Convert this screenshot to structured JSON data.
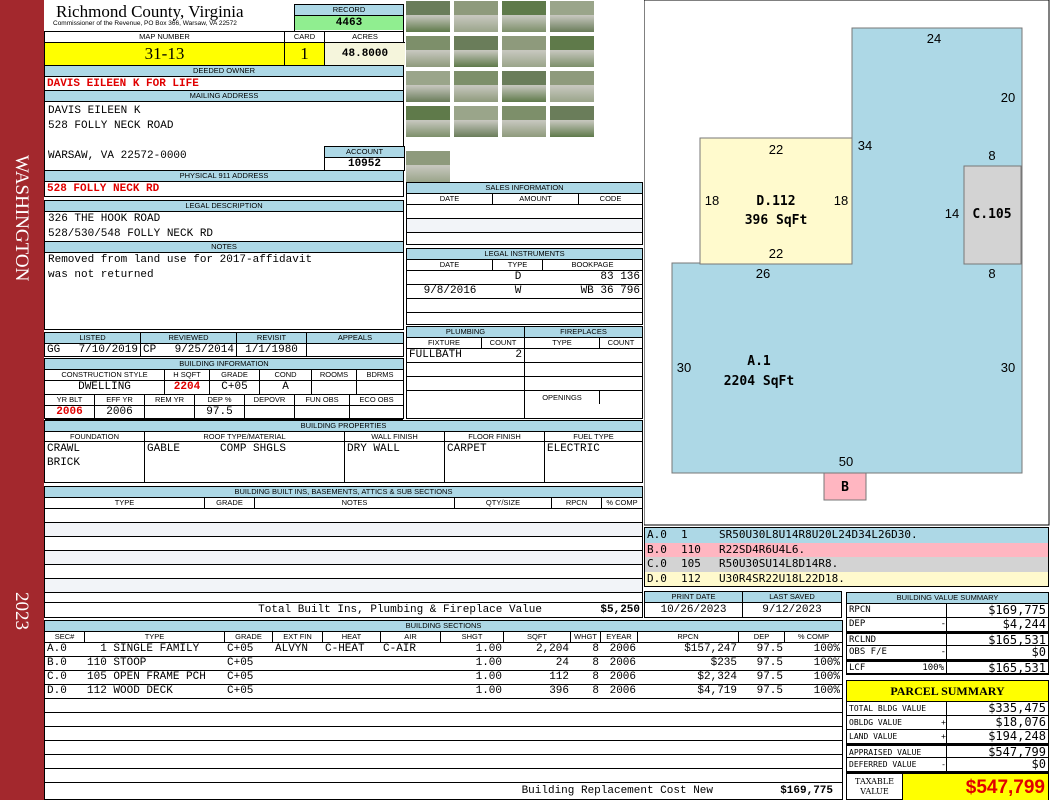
{
  "side": {
    "district": "WASHINGTON",
    "year": "2023"
  },
  "header": {
    "county": "Richmond County, Virginia",
    "subtitle": "Commissioner of the Revenue, PO Box 366, Warsaw, VA 22572",
    "record_label": "RECORD",
    "record": "4463"
  },
  "map": {
    "map_label": "MAP NUMBER",
    "map_number": "31-13",
    "card_label": "CARD",
    "card": "1",
    "acres_label": "ACRES",
    "acres": "48.8000"
  },
  "owner": {
    "label": "DEEDED OWNER",
    "name": "DAVIS EILEEN K FOR LIFE"
  },
  "mailing": {
    "label": "MAILING ADDRESS",
    "line1": "DAVIS EILEEN K",
    "line2": "528 FOLLY NECK ROAD",
    "line3": "WARSAW, VA 22572-0000",
    "account_label": "ACCOUNT",
    "account": "10952"
  },
  "physical": {
    "label": "PHYSICAL 911 ADDRESS",
    "address": "528 FOLLY NECK RD"
  },
  "legal": {
    "label": "LEGAL DESCRIPTION",
    "line1": "326 THE HOOK ROAD",
    "line2": "528/530/548 FOLLY NECK RD"
  },
  "notes": {
    "label": "NOTES",
    "line1": "Removed from land use for 2017-affidavit",
    "line2": "was not returned"
  },
  "sales": {
    "label": "SALES INFORMATION",
    "headers": [
      "DATE",
      "AMOUNT",
      "CODE"
    ]
  },
  "instruments": {
    "label": "LEGAL INSTRUMENTS",
    "headers": [
      "DATE",
      "TYPE",
      "BOOKPAGE"
    ],
    "rows": [
      [
        "",
        "D",
        "83 136"
      ],
      [
        "9/8/2016",
        "W",
        "WB 36 796"
      ]
    ]
  },
  "listed": {
    "headers": [
      "LISTED",
      "REVIEWED",
      "REVISIT",
      "APPEALS"
    ],
    "listed_by": "GG",
    "listed_date": "7/10/2019",
    "reviewed_by": "CP",
    "reviewed_date": "9/25/2014",
    "revisit": "1/1/1980",
    "appeals": ""
  },
  "building_info": {
    "label": "BUILDING INFORMATION",
    "headers1": [
      "CONSTRUCTION STYLE",
      "H SQFT",
      "GRADE",
      "COND",
      "ROOMS",
      "BDRMS"
    ],
    "values1": [
      "DWELLING",
      "2204",
      "C+05",
      "A",
      "",
      ""
    ],
    "headers2": [
      "YR BLT",
      "EFF YR",
      "REM YR",
      "DEP %",
      "DEPOVR",
      "FUN OBS",
      "ECO OBS"
    ],
    "values2": [
      "2006",
      "2006",
      "",
      "97.5",
      "",
      "",
      ""
    ]
  },
  "plumbing": {
    "label": "PLUMBING",
    "headers": [
      "FIXTURE",
      "COUNT"
    ],
    "fixture": "FULLBATH",
    "count": "2"
  },
  "fireplaces": {
    "label": "FIREPLACES",
    "headers": [
      "TYPE",
      "COUNT"
    ],
    "openings": "OPENINGS"
  },
  "properties": {
    "label": "BUILDING PROPERTIES",
    "headers": [
      "FOUNDATION",
      "ROOF TYPE/MATERIAL",
      "WALL FINISH",
      "FLOOR FINISH",
      "FUEL TYPE"
    ],
    "foundation1": "CRAWL",
    "foundation2": "BRICK",
    "roof_type": "GABLE",
    "roof_material": "COMP SHGLS",
    "wall": "DRY WALL",
    "floor": "CARPET",
    "fuel": "ELECTRIC"
  },
  "builtins": {
    "label": "BUILDING BUILT INS, BASEMENTS, ATTICS & SUB SECTIONS",
    "headers": [
      "TYPE",
      "GRADE",
      "NOTES",
      "QTY/SIZE",
      "RPCN",
      "% COMP"
    ],
    "total_label": "Total Built Ins, Plumbing & Fireplace Value",
    "total": "$5,250"
  },
  "sections": {
    "label": "BUILDING SECTIONS",
    "headers": [
      "SEC#",
      "TYPE",
      "GRADE",
      "EXT FIN",
      "HEAT",
      "AIR",
      "SHGT",
      "SQFT",
      "WHGT",
      "EYEAR",
      "RPCN",
      "DEP",
      "% COMP"
    ],
    "rows": [
      [
        "A.0",
        "  1 SINGLE FAMILY",
        "C+05",
        "ALVYN",
        "C-HEAT",
        "C-AIR",
        "1.00",
        "2,204",
        "8",
        "2006",
        "$157,247",
        "97.5",
        "100%"
      ],
      [
        "B.0",
        "110 STOOP",
        "C+05",
        "",
        "",
        "",
        "1.00",
        "24",
        "8",
        "2006",
        "$235",
        "97.5",
        "100%"
      ],
      [
        "C.0",
        "105 OPEN FRAME PCH",
        "C+05",
        "",
        "",
        "",
        "1.00",
        "112",
        "8",
        "2006",
        "$2,324",
        "97.5",
        "100%"
      ],
      [
        "D.0",
        "112 WOOD DECK",
        "C+05",
        "",
        "",
        "",
        "1.00",
        "396",
        "8",
        "2006",
        "$4,719",
        "97.5",
        "100%"
      ]
    ],
    "total_label": "Building Replacement Cost New",
    "total": "$169,775"
  },
  "sketch": {
    "labels": {
      "a_name": "A.1",
      "a_area": "2204 SqFt",
      "d_name": "D.112",
      "d_area": "396 SqFt",
      "c_name": "C.105",
      "b_name": "B"
    },
    "dims": {
      "top": "24",
      "right_upper": "20",
      "left_upper": "34",
      "d_top": "22",
      "d_left": "18",
      "d_right": "18",
      "d_bottom": "22",
      "c_top": "8",
      "c_left": "14",
      "c_bottom": "8",
      "a_top": "26",
      "a_left": "30",
      "a_right": "30",
      "bottom": "50"
    },
    "colors": {
      "a": "#add8e6",
      "b": "#ffb6c1",
      "c": "#d3d3d3",
      "d": "#fffacd"
    }
  },
  "legend": [
    [
      "A.0",
      "1",
      "SR50U30L8U14R8U20L24D34L26D30."
    ],
    [
      "B.0",
      "110",
      "R22SD4R6U4L6."
    ],
    [
      "C.0",
      "105",
      "R50U30SU14L8D14R8."
    ],
    [
      "D.0",
      "112",
      "U30R4SR22U18L22D18."
    ]
  ],
  "dates": {
    "print_label": "PRINT DATE",
    "print": "10/26/2023",
    "saved_label": "LAST SAVED",
    "saved": "9/12/2023"
  },
  "value_summary": {
    "label": "BUILDING VALUE SUMMARY",
    "rows": [
      [
        "RPCN",
        "",
        "$169,775"
      ],
      [
        "DEP",
        "-",
        "$4,244"
      ],
      [
        "RCLND",
        "",
        "$165,531"
      ],
      [
        "OBS F/E",
        "-",
        "$0"
      ],
      [
        "LCF",
        "100%",
        "$165,531"
      ]
    ]
  },
  "parcel": {
    "title": "PARCEL SUMMARY",
    "rows": [
      [
        "TOTAL BLDG VALUE",
        "",
        "$335,475"
      ],
      [
        "OBLDG VALUE",
        "+",
        "$18,076"
      ],
      [
        "LAND VALUE",
        "+",
        "$194,248"
      ],
      [
        "APPRAISED VALUE",
        "",
        "$547,799"
      ],
      [
        "DEFERRED VALUE",
        "-",
        "$0"
      ]
    ],
    "taxable_label1": "TAXABLE",
    "taxable_label2": "VALUE",
    "taxable": "$547,799"
  }
}
